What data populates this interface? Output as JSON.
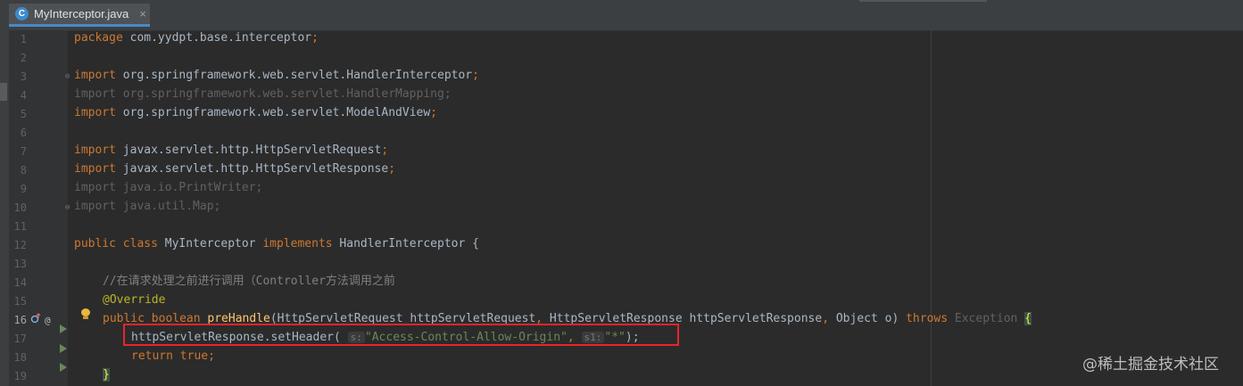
{
  "tab": {
    "title": "MyInterceptor.java",
    "icon_letter": "C",
    "close_glyph": "×",
    "icon": "java-class-icon"
  },
  "gutter": {
    "line_numbers": [
      "1",
      "2",
      "3",
      "4",
      "5",
      "6",
      "7",
      "8",
      "9",
      "10",
      "11",
      "12",
      "13",
      "14",
      "15",
      "16",
      "17",
      "18",
      "19"
    ],
    "current_line": "16",
    "markers": [
      "override-marker-icon",
      "annotation-marker-icon",
      "bulb-icon"
    ]
  },
  "code": {
    "l1": {
      "kw": "package",
      "rest": " com.yydpt.base.interceptor",
      "semi": ";"
    },
    "l3": {
      "kw": "import",
      "rest": " org.springframework.web.servlet.HandlerInterceptor",
      "semi": ";"
    },
    "l4": "import org.springframework.web.servlet.HandlerMapping;",
    "l5": {
      "kw": "import",
      "rest": " org.springframework.web.servlet.ModelAndView",
      "semi": ";"
    },
    "l7": {
      "kw": "import",
      "rest": " javax.servlet.http.HttpServletRequest",
      "semi": ";"
    },
    "l8": {
      "kw": "import",
      "rest": " javax.servlet.http.HttpServletResponse",
      "semi": ";"
    },
    "l9": "import java.io.PrintWriter;",
    "l10": "import java.util.Map;",
    "l12": {
      "kw1": "public class",
      "name": " MyInterceptor ",
      "kw2": "implements",
      "rest": " HandlerInterceptor {"
    },
    "l14": "//在请求处理之前进行调用（Controller方法调用之前",
    "l15": "@Override",
    "l16": {
      "kw1": "public boolean",
      "fn": "preHandle",
      "params1": "(HttpServletRequest httpServletRequest",
      "comma1": ",",
      "params2": " HttpServletResponse httpServletResponse",
      "comma2": ",",
      "params3": " Object o) ",
      "throws": "throws",
      "exc": " Exception ",
      "brace": "{"
    },
    "l17": {
      "call": "httpServletResponse.setHeader(",
      "hint1": "s:",
      "arg1": "\"Access-Control-Allow-Origin\"",
      "comma": ",",
      "hint2": "s1:",
      "arg2": "\"*\"",
      "end": ");"
    },
    "l18": {
      "kw": "return true",
      "semi": ";"
    },
    "l19": "}"
  },
  "watermark": "@稀土掘金技术社区",
  "colors": {
    "background": "#2b2b2b",
    "keyword": "#cc7832",
    "string": "#6a8759",
    "annotation": "#bbb529",
    "function": "#ffc66d",
    "highlight_box": "#e8242b"
  }
}
